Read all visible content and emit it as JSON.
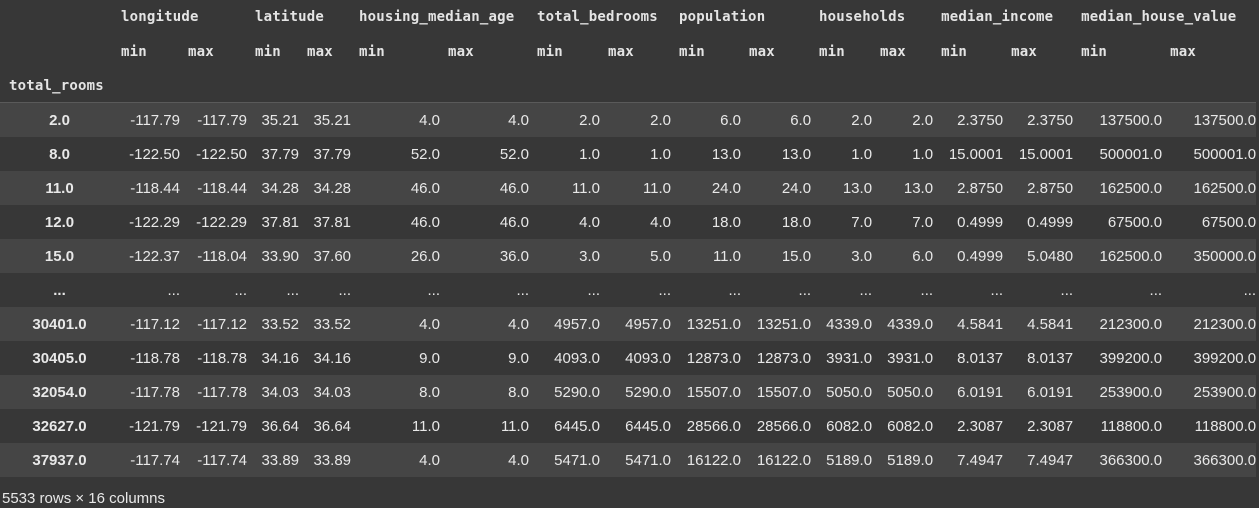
{
  "table": {
    "index_name": "total_rooms",
    "groups": [
      "longitude",
      "latitude",
      "housing_median_age",
      "total_bedrooms",
      "population",
      "households",
      "median_income",
      "median_house_value"
    ],
    "stats": [
      "min",
      "max"
    ],
    "rows": [
      {
        "idx": "2.0",
        "cells": [
          "-117.79",
          "-117.79",
          "35.21",
          "35.21",
          "4.0",
          "4.0",
          "2.0",
          "2.0",
          "6.0",
          "6.0",
          "2.0",
          "2.0",
          "2.3750",
          "2.3750",
          "137500.0",
          "137500.0"
        ]
      },
      {
        "idx": "8.0",
        "cells": [
          "-122.50",
          "-122.50",
          "37.79",
          "37.79",
          "52.0",
          "52.0",
          "1.0",
          "1.0",
          "13.0",
          "13.0",
          "1.0",
          "1.0",
          "15.0001",
          "15.0001",
          "500001.0",
          "500001.0"
        ]
      },
      {
        "idx": "11.0",
        "cells": [
          "-118.44",
          "-118.44",
          "34.28",
          "34.28",
          "46.0",
          "46.0",
          "11.0",
          "11.0",
          "24.0",
          "24.0",
          "13.0",
          "13.0",
          "2.8750",
          "2.8750",
          "162500.0",
          "162500.0"
        ]
      },
      {
        "idx": "12.0",
        "cells": [
          "-122.29",
          "-122.29",
          "37.81",
          "37.81",
          "46.0",
          "46.0",
          "4.0",
          "4.0",
          "18.0",
          "18.0",
          "7.0",
          "7.0",
          "0.4999",
          "0.4999",
          "67500.0",
          "67500.0"
        ]
      },
      {
        "idx": "15.0",
        "cells": [
          "-122.37",
          "-118.04",
          "33.90",
          "37.60",
          "26.0",
          "36.0",
          "3.0",
          "5.0",
          "11.0",
          "15.0",
          "3.0",
          "6.0",
          "0.4999",
          "5.0480",
          "162500.0",
          "350000.0"
        ]
      },
      {
        "idx": "...",
        "cells": [
          "...",
          "...",
          "...",
          "...",
          "...",
          "...",
          "...",
          "...",
          "...",
          "...",
          "...",
          "...",
          "...",
          "...",
          "...",
          "..."
        ]
      },
      {
        "idx": "30401.0",
        "cells": [
          "-117.12",
          "-117.12",
          "33.52",
          "33.52",
          "4.0",
          "4.0",
          "4957.0",
          "4957.0",
          "13251.0",
          "13251.0",
          "4339.0",
          "4339.0",
          "4.5841",
          "4.5841",
          "212300.0",
          "212300.0"
        ]
      },
      {
        "idx": "30405.0",
        "cells": [
          "-118.78",
          "-118.78",
          "34.16",
          "34.16",
          "9.0",
          "9.0",
          "4093.0",
          "4093.0",
          "12873.0",
          "12873.0",
          "3931.0",
          "3931.0",
          "8.0137",
          "8.0137",
          "399200.0",
          "399200.0"
        ]
      },
      {
        "idx": "32054.0",
        "cells": [
          "-117.78",
          "-117.78",
          "34.03",
          "34.03",
          "8.0",
          "8.0",
          "5290.0",
          "5290.0",
          "15507.0",
          "15507.0",
          "5050.0",
          "5050.0",
          "6.0191",
          "6.0191",
          "253900.0",
          "253900.0"
        ]
      },
      {
        "idx": "32627.0",
        "cells": [
          "-121.79",
          "-121.79",
          "36.64",
          "36.64",
          "11.0",
          "11.0",
          "6445.0",
          "6445.0",
          "28566.0",
          "28566.0",
          "6082.0",
          "6082.0",
          "2.3087",
          "2.3087",
          "118800.0",
          "118800.0"
        ]
      },
      {
        "idx": "37937.0",
        "cells": [
          "-117.74",
          "-117.74",
          "33.89",
          "33.89",
          "4.0",
          "4.0",
          "5471.0",
          "5471.0",
          "16122.0",
          "16122.0",
          "5189.0",
          "5189.0",
          "7.4947",
          "7.4947",
          "366300.0",
          "366300.0"
        ]
      }
    ],
    "footer": "5533 rows × 16 columns"
  }
}
